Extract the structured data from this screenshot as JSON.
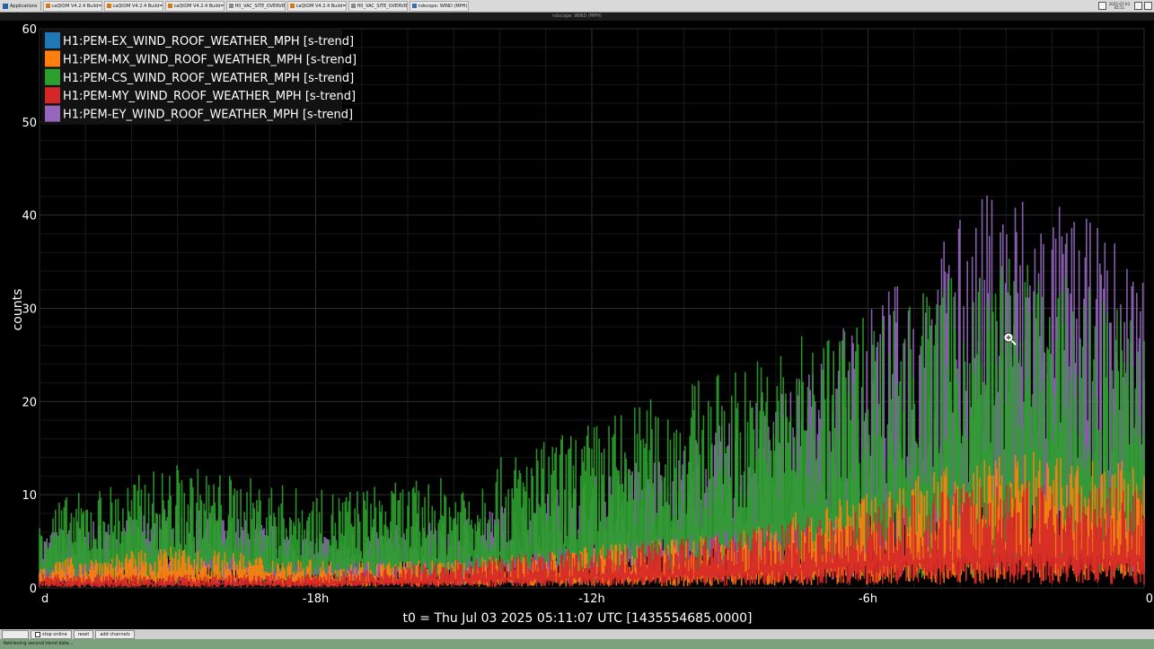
{
  "taskbar": {
    "apps_label": "Applications",
    "tasks": [
      {
        "label": "caQtDM V4.2.4 Build=No...",
        "color": "#d07a1a"
      },
      {
        "label": "caQtDM V4.2.4 Build=No...",
        "color": "#d07a1a"
      },
      {
        "label": "caQtDM V4.2.4 Build=No...",
        "color": "#d07a1a"
      },
      {
        "label": "H0_VAC_SITE_OVERVIEW...",
        "color": "#888888"
      },
      {
        "label": "caQtDM V4.2.4 Build=No...",
        "color": "#d07a1a"
      },
      {
        "label": "H0_VAC_SITE_OVERVIEW...",
        "color": "#888888"
      },
      {
        "label": "ndscope: WIND (MPH)",
        "color": "#3a6ea8"
      }
    ],
    "clock_date": "2025-07-03",
    "clock_time": "05:11"
  },
  "window": {
    "title": "ndscope: WIND (MPH)"
  },
  "buttons": {
    "stop_online": "stop online",
    "reset": "reset",
    "add_channels": "add channels"
  },
  "status": {
    "message": "Retrieving second trend data..."
  },
  "colors": {
    "background": "#000000",
    "ex": "#1f77b4",
    "mx": "#ff7f0e",
    "cs": "#2ca02c",
    "my": "#d62728",
    "ey": "#9467bd"
  },
  "chart_data": {
    "type": "line",
    "title": "",
    "xlabel": "t0 = Thu Jul 03 2025 05:11:07 UTC [1435554685.0000]",
    "ylabel": "counts",
    "xlim": [
      -24,
      0
    ],
    "ylim": [
      0,
      60
    ],
    "x_unit": "hours",
    "yticks": [
      0,
      10,
      20,
      30,
      40,
      50,
      60
    ],
    "xticks": [
      {
        "value": -24,
        "label": "d"
      },
      {
        "value": -18,
        "label": "-18h"
      },
      {
        "value": -12,
        "label": "-12h"
      },
      {
        "value": -6,
        "label": "-6h"
      },
      {
        "value": 0,
        "label": "0"
      }
    ],
    "grid": true,
    "legend_position": "top-left",
    "series": [
      {
        "name": "H1:PEM-EX_WIND_ROOF_WEATHER_MPH [s-trend]",
        "color": "#1f77b4",
        "x": [
          -24,
          -21,
          -18,
          -15,
          -12,
          -9,
          -6,
          -3,
          0
        ],
        "values": [
          0,
          0,
          0,
          0,
          0,
          0,
          0,
          0,
          0
        ]
      },
      {
        "name": "H1:PEM-MX_WIND_ROOF_WEATHER_MPH [s-trend]",
        "color": "#ff7f0e",
        "x": [
          -24,
          -21,
          -18,
          -15,
          -12,
          -9,
          -6,
          -3,
          0
        ],
        "values": [
          2,
          3,
          2,
          2,
          3,
          4,
          7,
          10,
          9
        ]
      },
      {
        "name": "H1:PEM-CS_WIND_ROOF_WEATHER_MPH [s-trend]",
        "color": "#2ca02c",
        "x": [
          -24,
          -21,
          -18,
          -15,
          -12,
          -9,
          -6,
          -3,
          0
        ],
        "values": [
          6,
          9,
          7,
          8,
          12,
          16,
          20,
          24,
          20
        ]
      },
      {
        "name": "H1:PEM-MY_WIND_ROOF_WEATHER_MPH [s-trend]",
        "color": "#d62728",
        "x": [
          -24,
          -21,
          -18,
          -15,
          -12,
          -9,
          -6,
          -3,
          0
        ],
        "values": [
          1,
          1,
          1,
          2,
          3,
          4,
          6,
          8,
          7
        ]
      },
      {
        "name": "H1:PEM-EY_WIND_ROOF_WEATHER_MPH [s-trend]",
        "color": "#9467bd",
        "x": [
          -24,
          -21,
          -18,
          -15,
          -12,
          -9,
          -6,
          -3,
          0
        ],
        "values": [
          4,
          6,
          4,
          5,
          8,
          12,
          20,
          30,
          24
        ]
      }
    ]
  }
}
